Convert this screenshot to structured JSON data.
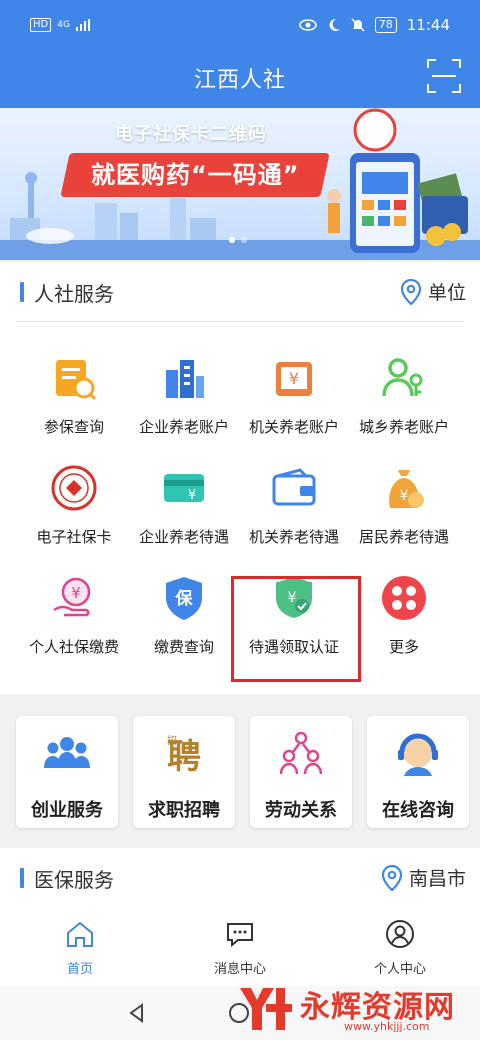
{
  "status_bar": {
    "network": "HD",
    "signal": "4G",
    "battery": "78",
    "time": "11:44"
  },
  "app_bar": {
    "title": "江西人社"
  },
  "banner": {
    "line1": "电子社保卡二维码",
    "line2": "就医购药“一码通”"
  },
  "hr_services": {
    "title": "人社服务",
    "location": "单位",
    "items": [
      {
        "label": "参保查询",
        "icon": "insurance-query-icon"
      },
      {
        "label": "企业养老账户",
        "icon": "enterprise-pension-account-icon"
      },
      {
        "label": "机关养老账户",
        "icon": "agency-pension-account-icon"
      },
      {
        "label": "城乡养老账户",
        "icon": "urban-rural-pension-account-icon"
      },
      {
        "label": "电子社保卡",
        "icon": "social-security-card-icon"
      },
      {
        "label": "企业养老待遇",
        "icon": "enterprise-pension-benefit-icon"
      },
      {
        "label": "机关养老待遇",
        "icon": "agency-pension-benefit-icon"
      },
      {
        "label": "居民养老待遇",
        "icon": "resident-pension-benefit-icon"
      },
      {
        "label": "个人社保缴费",
        "icon": "personal-payment-icon"
      },
      {
        "label": "缴费查询",
        "icon": "payment-query-icon"
      },
      {
        "label": "待遇领取认证",
        "icon": "benefit-certification-icon"
      },
      {
        "label": "更多",
        "icon": "more-icon"
      }
    ]
  },
  "feature_cards": [
    {
      "label": "创业服务",
      "icon": "entrepreneurship-icon"
    },
    {
      "label": "求职招聘",
      "icon": "recruitment-icon"
    },
    {
      "label": "劳动关系",
      "icon": "labor-relations-icon"
    },
    {
      "label": "在线咨询",
      "icon": "online-consult-icon"
    }
  ],
  "medical_services": {
    "title": "医保服务",
    "location": "南昌市"
  },
  "tab_bar": [
    {
      "label": "首页",
      "icon": "home-icon",
      "active": true
    },
    {
      "label": "消息中心",
      "icon": "message-icon",
      "active": false
    },
    {
      "label": "个人中心",
      "icon": "profile-icon",
      "active": false
    }
  ],
  "watermark": {
    "name": "永辉资源网",
    "url": "www.yhkjjj.com"
  },
  "colors": {
    "primary": "#3f86e8",
    "highlight": "#d92b2b",
    "watermark": "#e43a2c"
  }
}
